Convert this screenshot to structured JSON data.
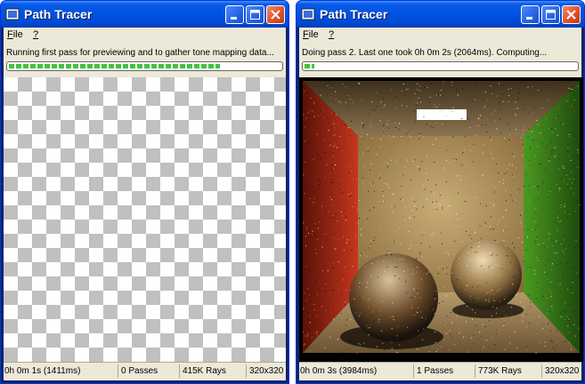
{
  "windows": [
    {
      "title": "Path Tracer",
      "menu": {
        "file_label": "ile",
        "file_accel": "F",
        "help_label": "?"
      },
      "status_text": "Running first pass for previewing and to gather tone mapping data...",
      "progress": 0.78,
      "statusbar": {
        "time": "0h 0m 1s (1411ms)",
        "passes": "0 Passes",
        "rays": "415K Rays",
        "size": "320x320"
      },
      "image_state": "transparent-checkerboard"
    },
    {
      "title": "Path Tracer",
      "menu": {
        "file_label": "ile",
        "file_accel": "F",
        "help_label": "?"
      },
      "status_text": "Doing pass 2. Last one took 0h 0m 2s (2064ms). Computing...",
      "progress": 0.05,
      "statusbar": {
        "time": "0h 0m 3s (3984ms)",
        "passes": "1 Passes",
        "rays": "773K Rays",
        "size": "320x320"
      },
      "image_state": "rendered-cornell-box"
    }
  ],
  "icons": {
    "app": "app-icon",
    "minimize": "minimize-icon",
    "maximize": "maximize-icon",
    "close": "close-icon"
  },
  "colors": {
    "titlebar": "#0054e3",
    "close_button": "#e0502b",
    "client": "#ece9d8",
    "progress_fill": "#3fc43f",
    "wall_red": "#c0301c",
    "wall_green": "#3f8a1c",
    "wall_back": "#b49560"
  }
}
